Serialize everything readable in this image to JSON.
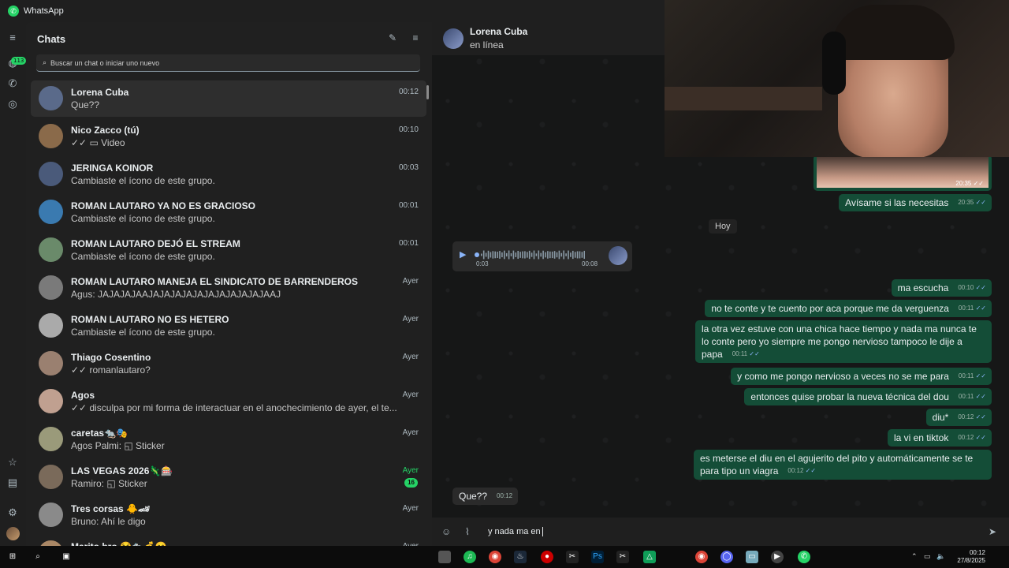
{
  "window": {
    "title": "WhatsApp"
  },
  "rail": {
    "unread_badge": "113"
  },
  "list": {
    "title": "Chats",
    "search_placeholder": "Buscar un chat o iniciar uno nuevo",
    "chats": [
      {
        "name": "Lorena Cuba",
        "preview": "Que??",
        "time": "00:12",
        "active": true
      },
      {
        "name": "Nico Zacco (tú)",
        "preview": "✓✓ ▭ Video",
        "time": "00:10"
      },
      {
        "name": "JERINGA KOINOR",
        "preview": "Cambiaste el ícono de este grupo.",
        "time": "00:03"
      },
      {
        "name": "ROMAN LAUTARO YA NO ES GRACIOSO",
        "preview": "Cambiaste el ícono de este grupo.",
        "time": "00:01"
      },
      {
        "name": "ROMAN LAUTARO DEJÓ EL STREAM",
        "preview": "Cambiaste el ícono de este grupo.",
        "time": "00:01"
      },
      {
        "name": "ROMAN LAUTARO MANEJA EL SINDICATO DE BARRENDEROS",
        "preview": "Agus: JAJAJAJAAJAJAJAJAJAJAJAJAJAJAJAAJ",
        "time": "Ayer"
      },
      {
        "name": "ROMAN LAUTARO NO ES HETERO",
        "preview": "Cambiaste el ícono de este grupo.",
        "time": "Ayer"
      },
      {
        "name": "Thiago Cosentino",
        "preview": "✓✓ romanlautaro?",
        "time": "Ayer"
      },
      {
        "name": "Agos",
        "preview": "✓✓ disculpa por mi forma de interactuar en el anochecimiento de ayer, el te...",
        "time": "Ayer"
      },
      {
        "name": "caretas🐀🎭",
        "preview": "Agos Palmi: ◱ Sticker",
        "time": "Ayer"
      },
      {
        "name": "LAS VEGAS 2026🦎🎰",
        "preview": "Ramiro: ◱ Sticker",
        "time": "Ayer",
        "unread": "16"
      },
      {
        "name": "Tres corsas 🐥🏎",
        "preview": "Bruno: Ahí le digo",
        "time": "Ayer"
      },
      {
        "name": "Marito bro 😂🐀💰😋",
        "preview": "",
        "time": "Ayer"
      }
    ]
  },
  "conversation": {
    "contact_name": "Lorena Cuba",
    "status": "en línea",
    "image_time": "20:35",
    "day_chip": "Hoy",
    "voice": {
      "elapsed": "0:03",
      "duration": "00:08"
    },
    "messages": [
      {
        "dir": "out",
        "text": "Avísame si las necesitas",
        "time": "20:35"
      },
      {
        "dir": "out",
        "text": "ma escucha",
        "time": "00:10"
      },
      {
        "dir": "out",
        "text": "no te conte y te cuento por aca porque me da verguenza",
        "time": "00:11"
      },
      {
        "dir": "out",
        "text": "la otra vez estuve con una chica hace tiempo y nada ma nunca te lo conte pero yo siempre me pongo nervioso tampoco le dije a papa",
        "time": "00:11"
      },
      {
        "dir": "out",
        "text": "y como me pongo nervioso a veces no se me para",
        "time": "00:11"
      },
      {
        "dir": "out",
        "text": "entonces quise probar la nueva técnica del dou",
        "time": "00:11"
      },
      {
        "dir": "out",
        "text": "diu*",
        "time": "00:12"
      },
      {
        "dir": "out",
        "text": "la vi en tiktok",
        "time": "00:12"
      },
      {
        "dir": "out",
        "text": "es meterse el diu en el agujerito del pito y automáticamente se te para tipo un viagra",
        "time": "00:12"
      },
      {
        "dir": "in",
        "text": "Que??",
        "time": "00:12"
      }
    ],
    "composer_text": "y nada ma en"
  },
  "taskbar": {
    "time": "00:12",
    "date": "27/8/2025"
  }
}
